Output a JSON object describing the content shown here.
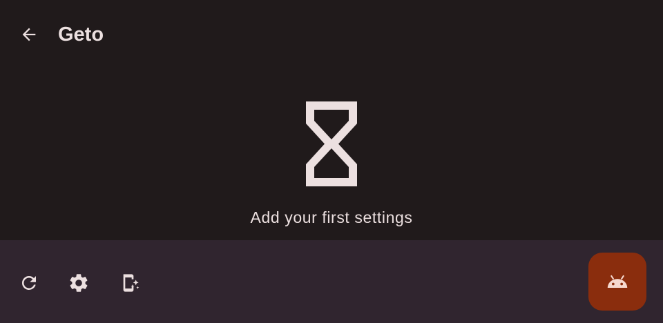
{
  "header": {
    "title": "Geto",
    "back_icon": "arrow-back-icon"
  },
  "empty_state": {
    "icon": "hourglass-icon",
    "message": "Add your first settings"
  },
  "bottom_bar": {
    "actions": [
      {
        "icon": "refresh-icon"
      },
      {
        "icon": "settings-gear-icon"
      },
      {
        "icon": "launch-app-icon"
      }
    ],
    "fab": {
      "icon": "android-icon",
      "color": "#8a2d0d"
    }
  },
  "colors": {
    "background": "#201a1b",
    "bottom_bar": "#30252f",
    "text": "#ece0e0",
    "fab": "#8a2d0d"
  }
}
